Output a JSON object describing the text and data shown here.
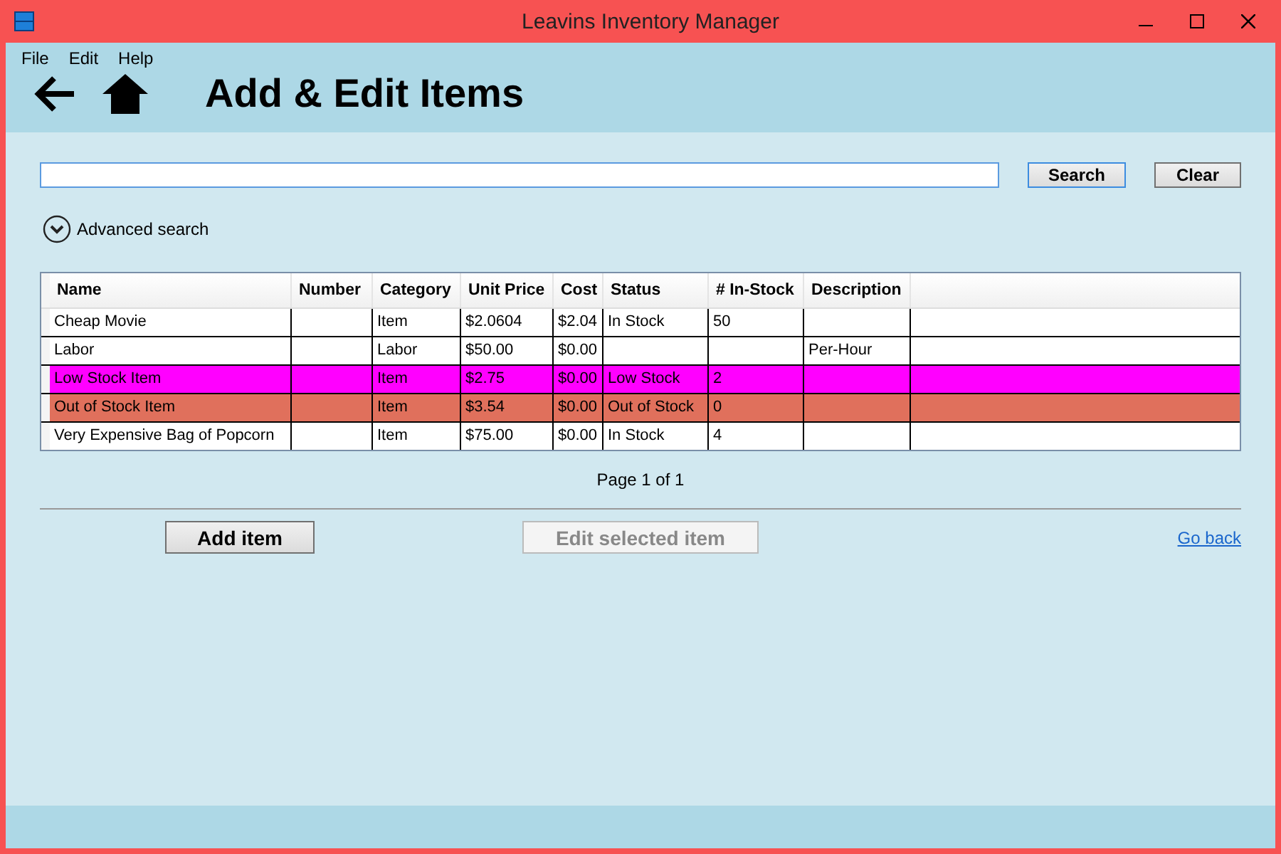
{
  "window": {
    "title": "Leavins Inventory Manager"
  },
  "menu": [
    {
      "label": "File"
    },
    {
      "label": "Edit"
    },
    {
      "label": "Help"
    }
  ],
  "page_title": "Add & Edit Items",
  "search": {
    "search_button": "Search",
    "clear_button": "Clear"
  },
  "advanced_search": {
    "label": "Advanced search",
    "expanded": false
  },
  "table": {
    "columns": [
      "Name",
      "Number",
      "Category",
      "Unit Price",
      "Cost",
      "Status",
      "# In-Stock",
      "Description"
    ],
    "rows": [
      {
        "cells": [
          "Cheap Movie",
          "",
          "Item",
          "$2.0604",
          "$2.04",
          "In Stock",
          "50",
          ""
        ],
        "color": "#ffffff"
      },
      {
        "cells": [
          "Labor",
          "",
          "Labor",
          "$50.00",
          "$0.00",
          "",
          "",
          "Per-Hour"
        ],
        "color": "#ffffff"
      },
      {
        "cells": [
          "Low Stock Item",
          "",
          "Item",
          "$2.75",
          "$0.00",
          "Low Stock",
          "2",
          ""
        ],
        "color": "#ff00ff"
      },
      {
        "cells": [
          "Out of Stock Item",
          "",
          "Item",
          "$3.54",
          "$0.00",
          "Out of Stock",
          "0",
          ""
        ],
        "color": "#e0705c"
      },
      {
        "cells": [
          "Very Expensive Bag of Popcorn",
          "",
          "Item",
          "$75.00",
          "$0.00",
          "In Stock",
          "4",
          ""
        ],
        "color": "#ffffff"
      }
    ]
  },
  "pager": "Page 1 of 1",
  "buttons": [
    {
      "label": "Add item",
      "disabled": false
    },
    {
      "label": "Edit selected item",
      "disabled": true
    }
  ],
  "go_back_link": "Go back"
}
